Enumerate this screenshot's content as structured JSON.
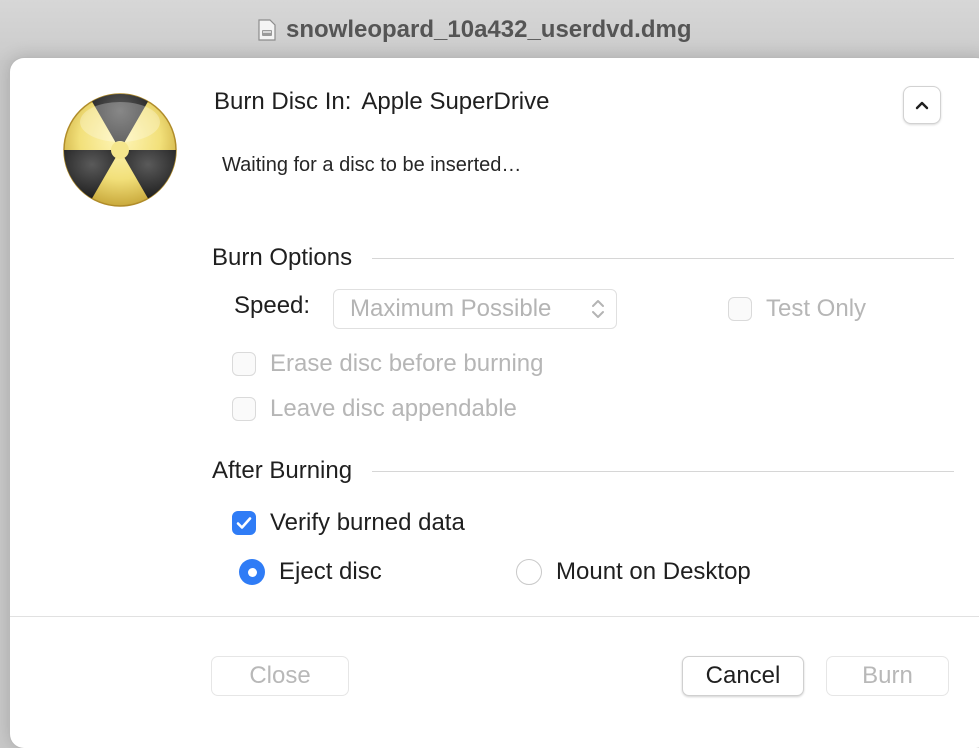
{
  "window": {
    "title": "snowleopard_10a432_userdvd.dmg",
    "title_icon": "disk-image-icon"
  },
  "header": {
    "app_icon": "burn-radiation-icon",
    "burn_in_label": "Burn Disc In:",
    "burn_in_value": "Apple SuperDrive",
    "disclosure_icon": "chevron-up-icon",
    "status": "Waiting for a disc to be inserted…"
  },
  "burn_options": {
    "heading": "Burn Options",
    "speed_label": "Speed:",
    "speed_value": "Maximum Possible",
    "speed_enabled": false,
    "test_only": {
      "label": "Test Only",
      "checked": false,
      "enabled": false
    },
    "erase": {
      "label": "Erase disc before burning",
      "checked": false,
      "enabled": false
    },
    "appendable": {
      "label": "Leave disc appendable",
      "checked": false,
      "enabled": false
    }
  },
  "after_burning": {
    "heading": "After Burning",
    "verify": {
      "label": "Verify burned data",
      "checked": true
    },
    "eject": {
      "label": "Eject disc",
      "selected": true
    },
    "mount": {
      "label": "Mount on Desktop",
      "selected": false
    }
  },
  "footer": {
    "close_label": "Close",
    "close_enabled": false,
    "cancel_label": "Cancel",
    "burn_label": "Burn",
    "burn_enabled": false
  },
  "colors": {
    "accent": "#2f7cf6",
    "icon_yellow": "#f2e07a",
    "icon_dark": "#3a3a3a"
  }
}
